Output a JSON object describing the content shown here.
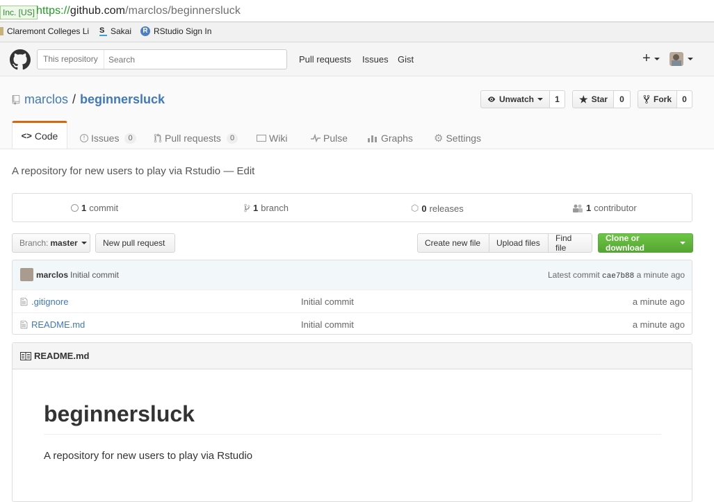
{
  "browser": {
    "ev_badge": "Inc. [US]",
    "url_scheme": "https://",
    "url_host": "github.com",
    "url_path": "/marclos/beginnersluck",
    "bookmarks": [
      "Claremont Colleges Li",
      "Sakai",
      "RStudio Sign In"
    ]
  },
  "header": {
    "search_scope": "This repository",
    "search_placeholder": "Search",
    "nav": [
      "Pull requests",
      "Issues",
      "Gist"
    ],
    "plus": "+"
  },
  "repo": {
    "owner": "marclos",
    "separator": "/",
    "name": "beginnersluck",
    "watch_label": "Unwatch",
    "watch_count": "1",
    "star_label": "Star",
    "star_count": "0",
    "fork_label": "Fork",
    "fork_count": "0"
  },
  "tabs": [
    {
      "label": "Code"
    },
    {
      "label": "Issues",
      "count": "0"
    },
    {
      "label": "Pull requests",
      "count": "0"
    },
    {
      "label": "Wiki"
    },
    {
      "label": "Pulse"
    },
    {
      "label": "Graphs"
    },
    {
      "label": "Settings"
    }
  ],
  "description": {
    "text": "A repository for new users to play via Rstudio",
    "dash": "—",
    "edit": "Edit"
  },
  "summary": {
    "commits_num": "1",
    "commits_label": "commit",
    "branches_num": "1",
    "branches_label": "branch",
    "releases_num": "0",
    "releases_label": "releases",
    "contributors_num": "1",
    "contributors_label": "contributor"
  },
  "file_nav": {
    "branch_prefix": "Branch:",
    "branch_name": "master",
    "new_pr": "New pull request",
    "create_file": "Create new file",
    "upload": "Upload files",
    "find": "Find file",
    "clone": "Clone or download"
  },
  "commit_tease": {
    "author": "marclos",
    "message": "Initial commit",
    "latest_label": "Latest commit",
    "sha": "cae7b88",
    "age": "a minute ago"
  },
  "files": [
    {
      "name": ".gitignore",
      "message": "Initial commit",
      "age": "a minute ago"
    },
    {
      "name": "README.md",
      "message": "Initial commit",
      "age": "a minute ago"
    }
  ],
  "readme": {
    "filename": "README.md",
    "h1": "beginnersluck",
    "paragraph": "A repository for new users to play via Rstudio"
  },
  "colors": {
    "link": "#4078c0",
    "active_tab_accent": "#d26911",
    "clone_green": "#6cc644"
  }
}
